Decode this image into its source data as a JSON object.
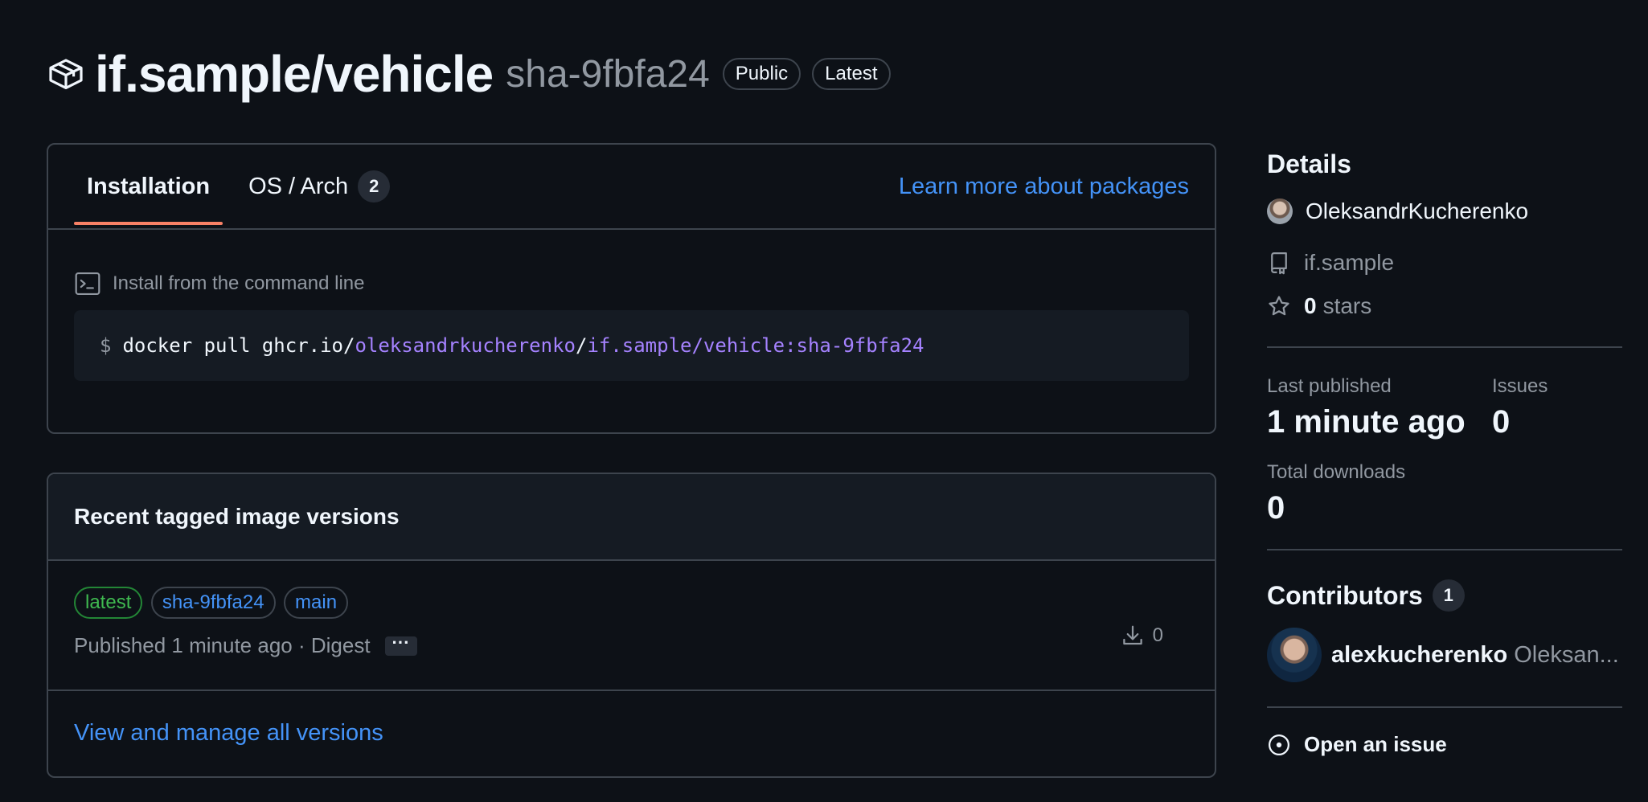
{
  "header": {
    "package_name": "if.sample/vehicle",
    "version": "sha-9fbfa24",
    "labels": [
      "Public",
      "Latest"
    ]
  },
  "install_box": {
    "tabs": [
      {
        "label": "Installation"
      },
      {
        "label": "OS / Arch",
        "count": "2"
      }
    ],
    "learn_link": "Learn more about packages",
    "command_title": "Install from the command line",
    "command": {
      "prompt": "$",
      "part1": "docker pull ghcr.io/",
      "owner": "oleksandrkucherenko",
      "slash": "/",
      "image": "if.sample/vehicle:sha-9fbfa24"
    }
  },
  "versions_box": {
    "title": "Recent tagged image versions",
    "row": {
      "tags": [
        "latest",
        "sha-9fbfa24",
        "main"
      ],
      "published": "Published 1 minute ago · Digest",
      "more": "···",
      "downloads": "0"
    },
    "view_all": "View and manage all versions"
  },
  "sidebar": {
    "details_title": "Details",
    "owner": "OleksandrKucherenko",
    "repo": "if.sample",
    "stars_count": "0",
    "stars_label": "stars",
    "last_published_label": "Last published",
    "last_published_value": "1 minute ago",
    "issues_label": "Issues",
    "issues_value": "0",
    "total_downloads_label": "Total downloads",
    "total_downloads_value": "0",
    "contributors_title": "Contributors",
    "contributors_count": "1",
    "contributor_login": "alexkucherenko",
    "contributor_name": "Oleksan...",
    "open_issue": "Open an issue"
  },
  "colors": {
    "background": "#0d1117",
    "link": "#4493f8",
    "tab_underline": "#f78166",
    "green_tag": "#3fb950",
    "code_purple": "#a582ff"
  },
  "icons": [
    "package-icon",
    "terminal-icon",
    "download-icon",
    "repo-icon",
    "star-icon",
    "issue-opened-icon"
  ]
}
